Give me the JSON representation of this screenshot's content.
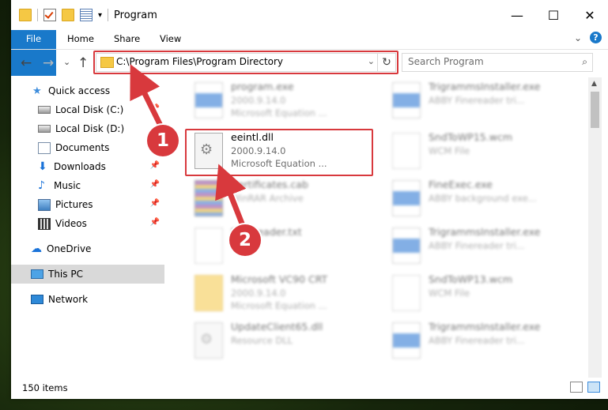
{
  "window": {
    "title": "Program",
    "caption": {
      "minimize": "—",
      "maximize": "☐",
      "close": "✕"
    }
  },
  "ribbon": {
    "tabs": [
      "File",
      "Home",
      "Share",
      "View"
    ],
    "expand_glyph": "⌄",
    "help_glyph": "?"
  },
  "navbar": {
    "back": "←",
    "forward": "→",
    "recent": "⌄",
    "up": "↑",
    "address": "C:\\Program Files\\Program Directory",
    "address_dropdown": "⌄",
    "refresh": "↻",
    "search_placeholder": "Search Program",
    "search_glyph": "⌕"
  },
  "sidebar": {
    "pin_glyph": "📌",
    "items": [
      {
        "label": "Quick access",
        "icon": "star-icon",
        "pinned": false
      },
      {
        "label": "Local Disk (C:)",
        "icon": "disk-icon",
        "pinned": true
      },
      {
        "label": "Local Disk (D:)",
        "icon": "disk-icon",
        "pinned": false
      },
      {
        "label": "Documents",
        "icon": "documents-icon",
        "pinned": true
      },
      {
        "label": "Downloads",
        "icon": "download-icon",
        "pinned": true
      },
      {
        "label": "Music",
        "icon": "music-icon",
        "pinned": true
      },
      {
        "label": "Pictures",
        "icon": "pictures-icon",
        "pinned": true
      },
      {
        "label": "Videos",
        "icon": "videos-icon",
        "pinned": true
      },
      {
        "label": "OneDrive",
        "icon": "cloud-icon",
        "pinned": false
      },
      {
        "label": "This PC",
        "icon": "pc-icon",
        "pinned": false,
        "selected": true
      },
      {
        "label": "Network",
        "icon": "network-icon",
        "pinned": false
      }
    ]
  },
  "files": [
    {
      "name": "program.exe",
      "line1": "2000.9.14.0",
      "line2": "Microsoft Equation ...",
      "icon": "exe"
    },
    {
      "name": "TrigrammsInstaller.exe",
      "line1": "ABBY Finereader tri...",
      "line2": "",
      "icon": "exe"
    },
    {
      "name": "eeintl.dll",
      "line1": "2000.9.14.0",
      "line2": "Microsoft Equation ...",
      "icon": "dll",
      "highlighted": true
    },
    {
      "name": "SndToWP15.wcm",
      "line1": "WCM File",
      "line2": "",
      "icon": "blank"
    },
    {
      "name": "Certificates.cab",
      "line1": "WinRAR Archive",
      "line2": "",
      "icon": "rar"
    },
    {
      "name": "FineExec.exe",
      "line1": "ABBY background exe...",
      "line2": "",
      "icon": "exe"
    },
    {
      "name": "FineReader.txt",
      "line1": "",
      "line2": "",
      "icon": "blank"
    },
    {
      "name": "TrigrammsInstaller.exe",
      "line1": "ABBY Finereader tri...",
      "line2": "",
      "icon": "exe"
    },
    {
      "name": "Microsoft VC90 CRT",
      "line1": "2000.9.14.0",
      "line2": "Microsoft Equation ...",
      "icon": "vc"
    },
    {
      "name": "SndToWP13.wcm",
      "line1": "WCM File",
      "line2": "",
      "icon": "blank"
    },
    {
      "name": "UpdateClient65.dll",
      "line1": "Resource DLL",
      "line2": "",
      "icon": "dll"
    },
    {
      "name": "TrigrammsInstaller.exe",
      "line1": "ABBY Finereader tri...",
      "line2": "",
      "icon": "exe"
    }
  ],
  "status": {
    "item_count": "150 items"
  },
  "annotations": {
    "badge1": "1",
    "badge2": "2",
    "color": "#d8393d"
  }
}
